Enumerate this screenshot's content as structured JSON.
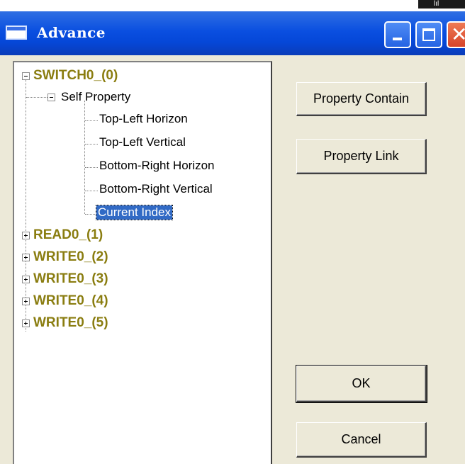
{
  "window": {
    "title": "Advance",
    "corner_text": "lıl"
  },
  "tree": {
    "roots": [
      {
        "label": "SWITCH0_(0)",
        "expanded": true
      },
      {
        "label": "READ0_(1)",
        "expanded": false
      },
      {
        "label": "WRITE0_(2)",
        "expanded": false
      },
      {
        "label": "WRITE0_(3)",
        "expanded": false
      },
      {
        "label": "WRITE0_(4)",
        "expanded": false
      },
      {
        "label": "WRITE0_(5)",
        "expanded": false
      }
    ],
    "self_property": {
      "label": "Self Property",
      "children": [
        "Top-Left Horizon",
        "Top-Left Vertical",
        "Bottom-Right Horizon",
        "Bottom-Right Vertical",
        "Current Index"
      ],
      "selected_index": 4
    }
  },
  "buttons": {
    "property_contain": "Property Contain",
    "property_link": "Property Link",
    "ok": "OK",
    "cancel": "Cancel"
  },
  "colors": {
    "titlebar": "#0a4fe0",
    "root_node_text": "#8a7d10",
    "selection": "#316ac5",
    "dialog_background": "#ece9d8"
  }
}
